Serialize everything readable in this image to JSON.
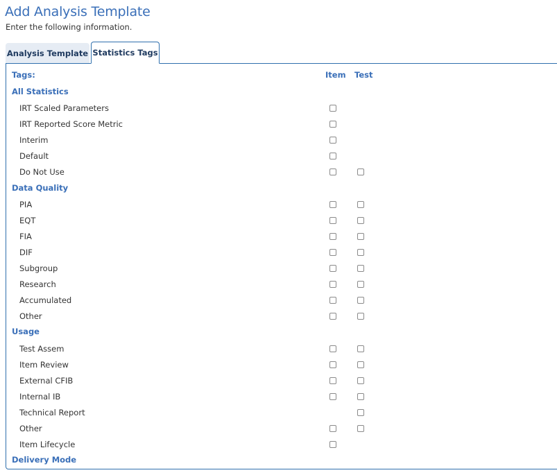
{
  "header": {
    "title": "Add Analysis Template",
    "subtitle": "Enter the following information."
  },
  "tabs": [
    {
      "label": "Analysis Template",
      "active": false
    },
    {
      "label": "Statistics Tags",
      "active": true
    }
  ],
  "table": {
    "tags_label": "Tags:",
    "columns": [
      "Item",
      "Test"
    ]
  },
  "groups": [
    {
      "name": "All Statistics",
      "tags": [
        {
          "label": "IRT Scaled Parameters",
          "item": true,
          "test": false,
          "item_checked": false,
          "test_checked": false
        },
        {
          "label": "IRT Reported Score Metric",
          "item": true,
          "test": false,
          "item_checked": false,
          "test_checked": false
        },
        {
          "label": "Interim",
          "item": true,
          "test": false,
          "item_checked": false,
          "test_checked": false
        },
        {
          "label": "Default",
          "item": true,
          "test": false,
          "item_checked": false,
          "test_checked": false
        },
        {
          "label": "Do Not Use",
          "item": true,
          "test": true,
          "item_checked": false,
          "test_checked": false
        }
      ]
    },
    {
      "name": "Data Quality",
      "tags": [
        {
          "label": "PIA",
          "item": true,
          "test": true,
          "item_checked": false,
          "test_checked": false
        },
        {
          "label": "EQT",
          "item": true,
          "test": true,
          "item_checked": false,
          "test_checked": false
        },
        {
          "label": "FIA",
          "item": true,
          "test": true,
          "item_checked": false,
          "test_checked": false
        },
        {
          "label": "DIF",
          "item": true,
          "test": true,
          "item_checked": false,
          "test_checked": false
        },
        {
          "label": "Subgroup",
          "item": true,
          "test": true,
          "item_checked": false,
          "test_checked": false
        },
        {
          "label": "Research",
          "item": true,
          "test": true,
          "item_checked": false,
          "test_checked": false
        },
        {
          "label": "Accumulated",
          "item": true,
          "test": true,
          "item_checked": false,
          "test_checked": false
        },
        {
          "label": "Other",
          "item": true,
          "test": true,
          "item_checked": false,
          "test_checked": false
        }
      ]
    },
    {
      "name": "Usage",
      "tags": [
        {
          "label": "Test Assem",
          "item": true,
          "test": true,
          "item_checked": false,
          "test_checked": false
        },
        {
          "label": "Item Review",
          "item": true,
          "test": true,
          "item_checked": false,
          "test_checked": false
        },
        {
          "label": "External CFIB",
          "item": true,
          "test": true,
          "item_checked": false,
          "test_checked": false
        },
        {
          "label": "Internal IB",
          "item": true,
          "test": true,
          "item_checked": false,
          "test_checked": false
        },
        {
          "label": "Technical Report",
          "item": false,
          "test": true,
          "item_checked": false,
          "test_checked": false
        },
        {
          "label": "Other",
          "item": true,
          "test": true,
          "item_checked": false,
          "test_checked": false
        },
        {
          "label": "Item Lifecycle",
          "item": true,
          "test": false,
          "item_checked": false,
          "test_checked": false
        }
      ]
    },
    {
      "name": "Delivery Mode",
      "tags": []
    }
  ],
  "colors": {
    "accent": "#3a6fb8",
    "border": "#2f6fad",
    "inactive_tab_bg": "#e6ecf4",
    "text": "#333333"
  }
}
